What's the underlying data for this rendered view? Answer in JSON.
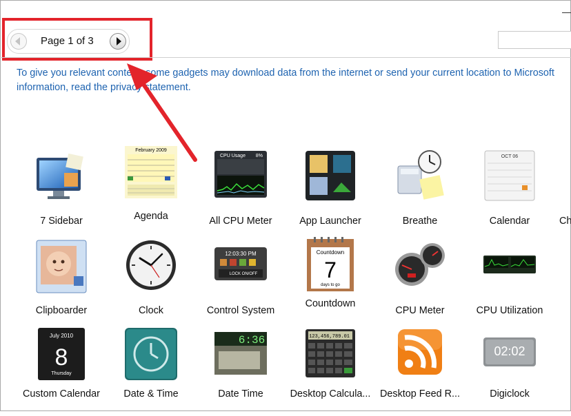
{
  "pager": {
    "label": "Page 1 of 3"
  },
  "search": {
    "placeholder": ""
  },
  "notice": {
    "line1": "To give you relevant content, some gadgets may download data from the internet or send your current location to Microsoft",
    "line2": "information, read the privacy statement."
  },
  "gadgets": [
    {
      "label": "7 Sidebar",
      "icon": "monitor-sidebar-icon"
    },
    {
      "label": "Agenda",
      "icon": "agenda-calendar-icon"
    },
    {
      "label": "All CPU Meter",
      "icon": "cpu-usage-meter-icon"
    },
    {
      "label": "App Launcher",
      "icon": "app-launcher-icon"
    },
    {
      "label": "Breathe",
      "icon": "clock-calculator-note-icon"
    },
    {
      "label": "Calendar",
      "icon": "calendar-oct-icon"
    },
    {
      "label": "Ch",
      "icon": ""
    },
    {
      "label": "Clipboarder",
      "icon": "baby-photo-clipboard-icon"
    },
    {
      "label": "Clock",
      "icon": "analog-clock-icon"
    },
    {
      "label": "Control System",
      "icon": "control-system-icon"
    },
    {
      "label": "Countdown",
      "icon": "countdown-7-days-icon"
    },
    {
      "label": "CPU Meter",
      "icon": "cpu-meter-gauges-icon"
    },
    {
      "label": "CPU Utilization",
      "icon": "cpu-utilization-graphs-icon"
    },
    {
      "label": "Custom Calendar",
      "icon": "custom-calendar-8-icon"
    },
    {
      "label": "Date & Time",
      "icon": "date-time-clock-icon"
    },
    {
      "label": "Date Time",
      "icon": "digital-date-time-icon"
    },
    {
      "label": "Desktop Calcula...",
      "icon": "desktop-calculator-icon"
    },
    {
      "label": "Desktop Feed R...",
      "icon": "rss-feed-icon"
    },
    {
      "label": "Digiclock",
      "icon": "digital-clock-icon"
    }
  ],
  "icon_text": {
    "agenda_month": "February 2009",
    "cpu_title": "CPU Usage",
    "cpu_pct": "8%",
    "cal_month": "OCT 06",
    "ctrl_time": "12:03:30 PM",
    "ctrl_lock": "LOCK ON/OFF",
    "countdown_title": "Countdown",
    "countdown_num": "7",
    "countdown_sub": "days to go",
    "custom_month": "July 2010",
    "custom_day": "8",
    "custom_weekday": "Thursday",
    "datetime_digits": "6:36",
    "calc_display": "123,456,789.01",
    "digi_time": "02:02"
  },
  "colors": {
    "link": "#1e63b0",
    "highlight": "#e3242b"
  }
}
